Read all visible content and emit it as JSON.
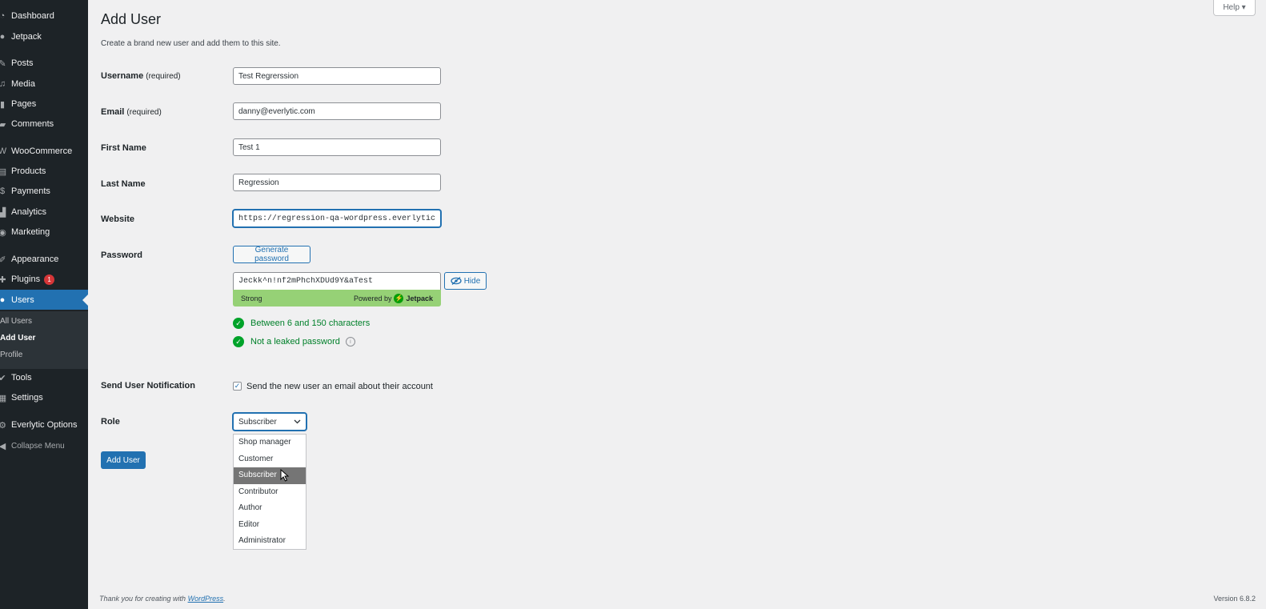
{
  "sidebar": {
    "items": [
      {
        "label": "Dashboard",
        "icon": "dashboard-icon"
      },
      {
        "label": "Jetpack",
        "icon": "jetpack-icon"
      },
      {
        "label": "Posts",
        "icon": "pin-icon"
      },
      {
        "label": "Media",
        "icon": "media-icon"
      },
      {
        "label": "Pages",
        "icon": "page-icon"
      },
      {
        "label": "Comments",
        "icon": "comment-icon"
      },
      {
        "label": "WooCommerce",
        "icon": "woocommerce-icon"
      },
      {
        "label": "Products",
        "icon": "archive-icon"
      },
      {
        "label": "Payments",
        "icon": "dollar-icon"
      },
      {
        "label": "Analytics",
        "icon": "bar-chart-icon"
      },
      {
        "label": "Marketing",
        "icon": "megaphone-icon"
      },
      {
        "label": "Appearance",
        "icon": "paintbrush-icon"
      },
      {
        "label": "Plugins",
        "icon": "plug-icon",
        "badge": "1"
      },
      {
        "label": "Users",
        "icon": "user-icon"
      },
      {
        "label": "Tools",
        "icon": "wrench-icon"
      },
      {
        "label": "Settings",
        "icon": "settings-icon"
      },
      {
        "label": "Everlytic Options",
        "icon": "gear-icon"
      },
      {
        "label": "Collapse Menu",
        "icon": "collapse-icon"
      }
    ],
    "submenu": [
      "All Users",
      "Add User",
      "Profile"
    ],
    "active_color": "#2271b1"
  },
  "header": {
    "title": "Add User",
    "description": "Create a brand new user and add them to this site.",
    "help": "Help ▾"
  },
  "form": {
    "username_label": "Username",
    "email_label": "Email",
    "required": "(required)",
    "username": "Test Regrerssion",
    "email": "danny@everlytic.com",
    "first_name_label": "First Name",
    "first_name": "Test 1",
    "last_name_label": "Last Name",
    "last_name": "Regression",
    "website_label": "Website",
    "website": "https://regression-qa-wordpress.everlytic.n",
    "password_label": "Password",
    "generate_password": "Generate password",
    "password": "Jeckk^n!nf2mPhchXDUd9Y&aTest",
    "hide": "Hide",
    "strength": "Strong",
    "powered_by": "Powered by",
    "jetpack": "Jetpack",
    "check1": "Between 6 and 150 characters",
    "check2": "Not a leaked password",
    "notification_label": "Send User Notification",
    "notification_text": "Send the new user an email about their account",
    "role_label": "Role",
    "role_selected": "Subscriber",
    "role_options": [
      "Shop manager",
      "Customer",
      "Subscriber",
      "Contributor",
      "Author",
      "Editor",
      "Administrator"
    ],
    "submit": "Add User",
    "strength_color": "#96d176"
  },
  "footer": {
    "thanks": "Thank you for creating with",
    "wordpress": "WordPress",
    "version": "Version 6.8.2"
  }
}
